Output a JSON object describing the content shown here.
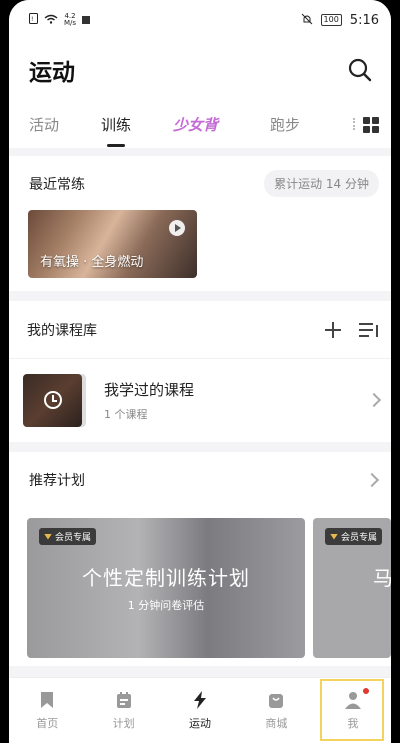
{
  "status_bar": {
    "network_speed_value": "4.2",
    "network_speed_unit": "M/s",
    "battery": "100",
    "time": "5:16"
  },
  "header": {
    "title": "运动"
  },
  "tabs": [
    {
      "label": "活动"
    },
    {
      "label": "训练"
    },
    {
      "label": "少女背"
    },
    {
      "label": "跑步"
    }
  ],
  "recent": {
    "title": "最近常练",
    "total_badge": "累计运动 14 分钟",
    "course_label": "有氧操 · 全身燃动"
  },
  "library": {
    "title": "我的课程库",
    "item_name": "我学过的课程",
    "item_count": "1 个课程"
  },
  "plans": {
    "title": "推荐计划",
    "cards": [
      {
        "badge": "会员专属",
        "title": "个性定制训练计划",
        "subtitle": "1 分钟问卷评估"
      },
      {
        "badge": "会员专属",
        "title": "马"
      }
    ]
  },
  "tabbar": [
    {
      "label": "首页"
    },
    {
      "label": "计划"
    },
    {
      "label": "运动"
    },
    {
      "label": "商城"
    },
    {
      "label": "我"
    }
  ]
}
